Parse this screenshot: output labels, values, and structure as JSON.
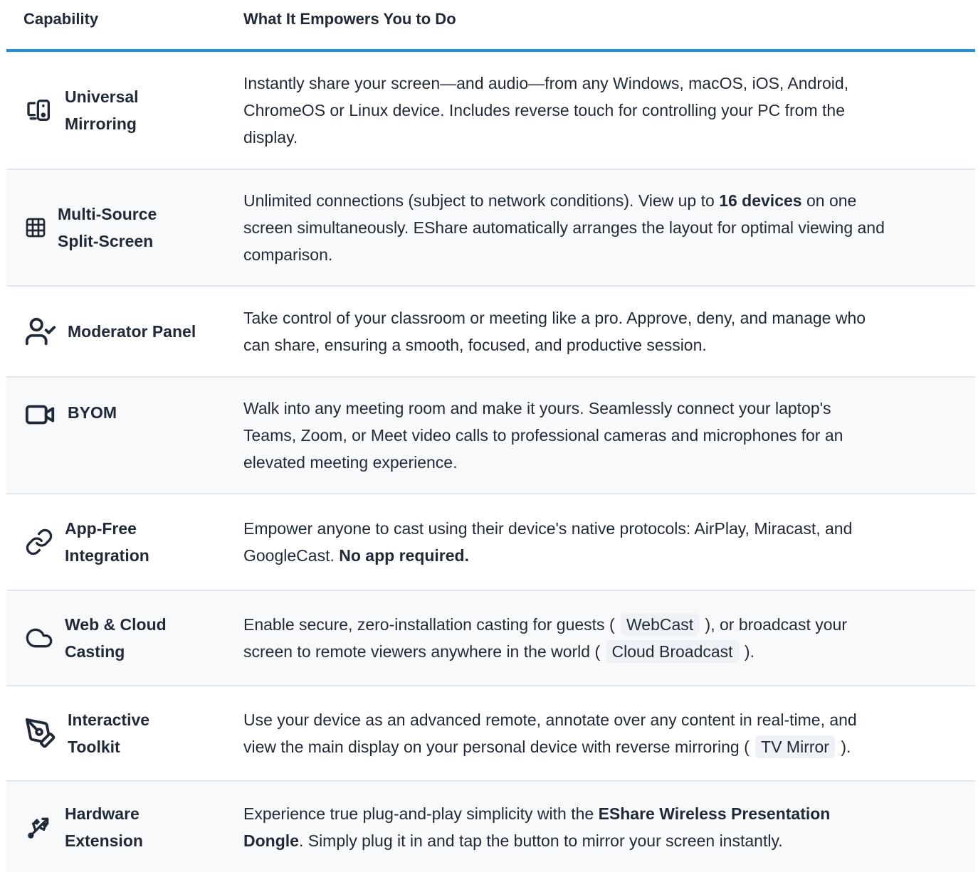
{
  "header": {
    "col_capability": "Capability",
    "col_description": "What It Empowers You to Do"
  },
  "rows": [
    {
      "icon": "devices-icon",
      "name_l1": "Universal",
      "name_l2": "Mirroring",
      "d1": "Instantly share your screen—and audio—from any Windows, macOS, iOS, Android,",
      "d2": "ChromeOS or Linux device. Includes reverse touch for controlling your PC from the",
      "d3": "display."
    },
    {
      "icon": "grid-icon",
      "name_l1": "Multi-Source",
      "name_l2": "Split-Screen",
      "d1a": "Unlimited connections (subject to network conditions). View up to ",
      "d1b": "16 devices",
      "d1c": " on one",
      "d2": "screen simultaneously. EShare automatically arranges the layout for optimal viewing and",
      "d3": "comparison."
    },
    {
      "icon": "user-check-icon",
      "name_l1": "Moderator Panel",
      "d1": "Take control of your classroom or meeting like a pro. Approve, deny, and manage who",
      "d2": "can share, ensuring a smooth, focused, and productive session."
    },
    {
      "icon": "video-camera-icon",
      "name_l1": "BYOM",
      "d1": "Walk into any meeting room and make it yours. Seamlessly connect your laptop's",
      "d2": "Teams, Zoom, or Meet video calls to professional cameras and microphones for an",
      "d3": "elevated meeting experience."
    },
    {
      "icon": "link-icon",
      "name_l1": "App-Free",
      "name_l2": "Integration",
      "d1": "Empower anyone to cast using their device's native protocols: AirPlay, Miracast, and",
      "d2a": "GoogleCast. ",
      "d2b": "No app required."
    },
    {
      "icon": "cloud-icon",
      "name_l1": "Web & Cloud",
      "name_l2": "Casting",
      "d1a": "Enable secure, zero-installation casting for guests ( ",
      "d1tag": "WebCast",
      "d1b": " ), or broadcast your",
      "d2a": "screen to remote viewers anywhere in the world ( ",
      "d2tag": "Cloud Broadcast",
      "d2b": " )."
    },
    {
      "icon": "pen-tool-icon",
      "name_l1": "Interactive",
      "name_l2": "Toolkit",
      "d1": "Use your device as an advanced remote, annotate over any content in real-time, and",
      "d2a": "view the main display on your personal device with reverse mirroring ( ",
      "d2tag": "TV Mirror",
      "d2b": " )."
    },
    {
      "icon": "usb-icon",
      "name_l1": "Hardware",
      "name_l2": "Extension",
      "d1a": "Experience true plug-and-play simplicity with the ",
      "d1b": "EShare Wireless Presentation",
      "d2a": "Dongle",
      "d2b": ". Simply plug it in and tap the button to mirror your screen instantly."
    }
  ]
}
